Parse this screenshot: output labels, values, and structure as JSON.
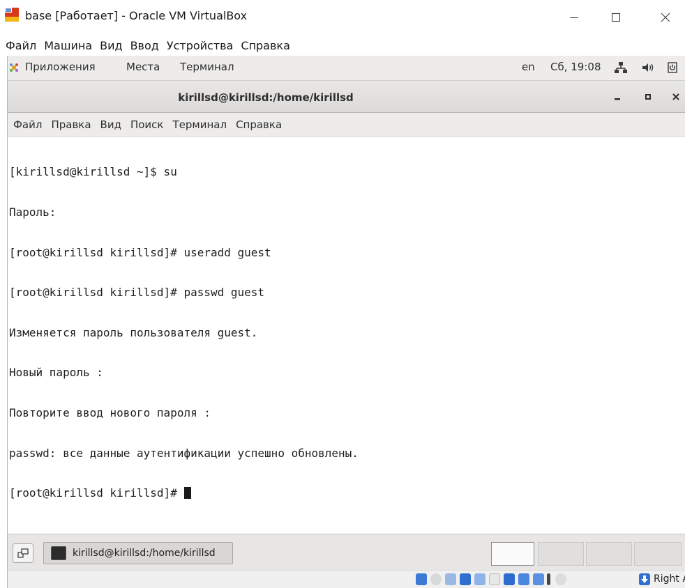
{
  "host_window": {
    "title": "base [Работает] - Oracle VM VirtualBox",
    "menu": [
      "Файл",
      "Машина",
      "Вид",
      "Ввод",
      "Устройства",
      "Справка"
    ]
  },
  "gnome_panel": {
    "applications": "Приложения",
    "places": "Места",
    "terminal": "Терминал",
    "language": "en",
    "clock": "Сб, 19:08"
  },
  "terminal": {
    "title": "kirillsd@kirillsd:/home/kirillsd",
    "menu": [
      "Файл",
      "Правка",
      "Вид",
      "Поиск",
      "Терминал",
      "Справка"
    ],
    "lines": [
      "[kirillsd@kirillsd ~]$ su",
      "Пароль:",
      "[root@kirillsd kirillsd]# useradd guest",
      "[root@kirillsd kirillsd]# passwd guest",
      "Изменяется пароль пользователя guest.",
      "Новый пароль :",
      "Повторите ввод нового пароля :",
      "passwd: все данные аутентификации успешно обновлены.",
      "[root@kirillsd kirillsd]#"
    ]
  },
  "taskbar": {
    "task_label": "kirillsd@kirillsd:/home/kirillsd",
    "workspaces": 4,
    "active_workspace": 1
  },
  "statusbar": {
    "host_key": "Right Alt"
  },
  "colors": {
    "panel": "#edeceb",
    "terminal_bg": "#ffffff",
    "terminal_fg": "#1e1e1e",
    "host_accent": "#d63a1a"
  }
}
